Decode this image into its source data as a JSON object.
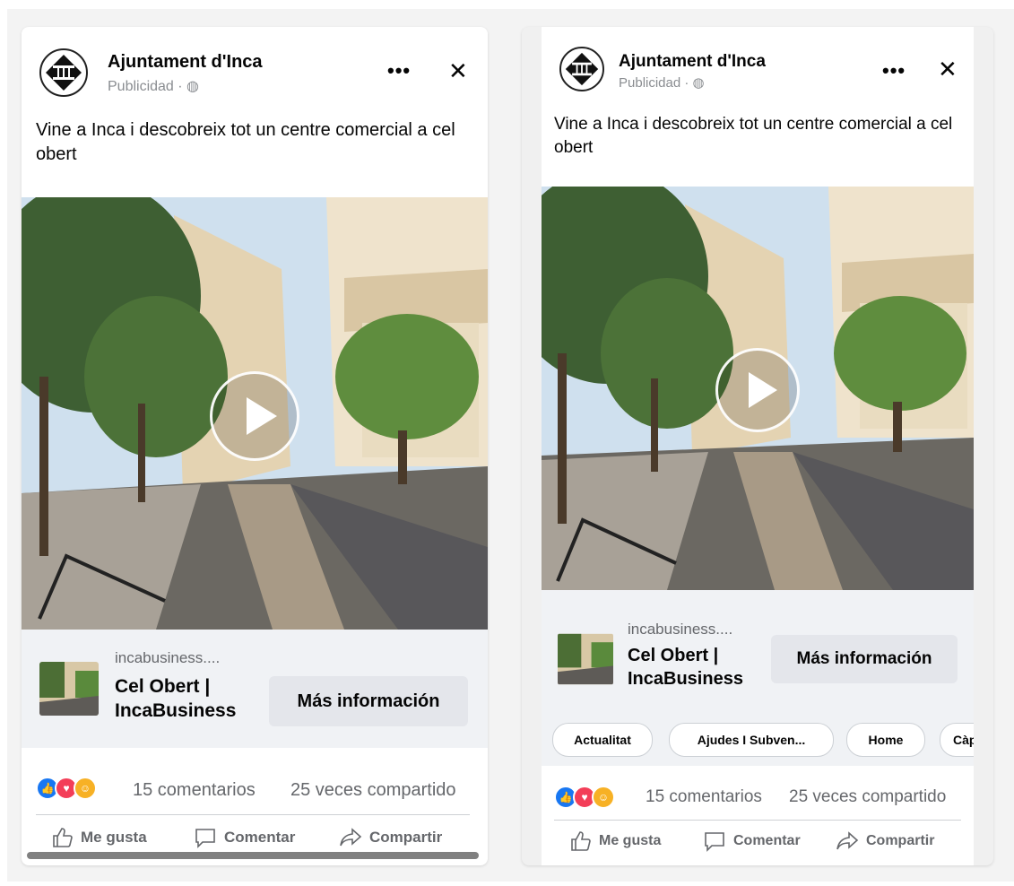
{
  "posts": [
    {
      "page_name": "Ajuntament d'Inca",
      "sponsored_label": "Publicidad · ",
      "more_icon": "•••",
      "close_icon": "✕",
      "caption": "Vine a Inca i descobreix tot un centre comercial a cel obert",
      "link_domain": "incabusiness....",
      "link_title": "Cel Obert | IncaBusiness",
      "cta_label": "Más información",
      "comments_count": "15 comentarios",
      "shares_count": "25 veces compartido",
      "like_label": "Me gusta",
      "comment_label": "Comentar",
      "share_label": "Compartir"
    },
    {
      "page_name": "Ajuntament d'Inca",
      "sponsored_label": "Publicidad · ",
      "more_icon": "•••",
      "close_icon": "✕",
      "caption": "Vine a Inca i descobreix tot un centre comercial a cel obert",
      "link_domain": "incabusiness....",
      "link_title": "Cel Obert | IncaBusiness",
      "cta_label": "Más información",
      "chips": [
        "Actualitat",
        "Ajudes I Subven...",
        "Home",
        "Càp"
      ],
      "comments_count": "15 comentarios",
      "shares_count": "25 veces compartido",
      "like_label": "Me gusta",
      "comment_label": "Comentar",
      "share_label": "Compartir"
    }
  ],
  "colors": {
    "like_blue": "#1877f2",
    "love_red": "#f33e58",
    "care_yellow": "#f7b125",
    "cta_bg": "#e4e6eb",
    "secondary_text": "#65676b"
  },
  "icons": [
    "globe-icon",
    "more-icon",
    "close-icon",
    "play-icon",
    "like-icon",
    "comment-icon",
    "share-icon",
    "like-reaction-icon",
    "love-reaction-icon",
    "care-reaction-icon"
  ]
}
